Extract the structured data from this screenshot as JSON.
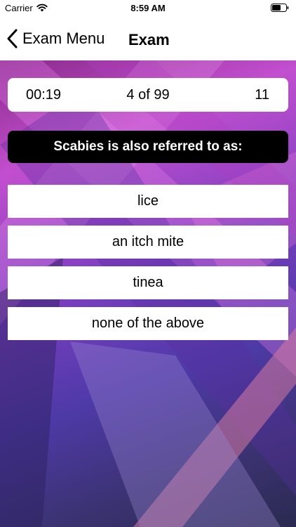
{
  "status_bar": {
    "carrier": "Carrier",
    "time": "8:59 AM"
  },
  "nav": {
    "back_label": "Exam Menu",
    "title": "Exam"
  },
  "exam": {
    "timer": "00:19",
    "progress": "4 of 99",
    "score": "11",
    "question": "Scabies is also referred to as:",
    "answers": [
      "lice",
      "an itch mite",
      "tinea",
      "none of the above"
    ]
  },
  "colors": {
    "background_accent": "#c24fcf",
    "background_dark": "#3a3270",
    "question_bg": "#000000",
    "answer_bg": "#ffffff"
  },
  "icons": {
    "back": "chevron-left-icon",
    "wifi": "wifi-icon",
    "battery": "battery-icon"
  }
}
